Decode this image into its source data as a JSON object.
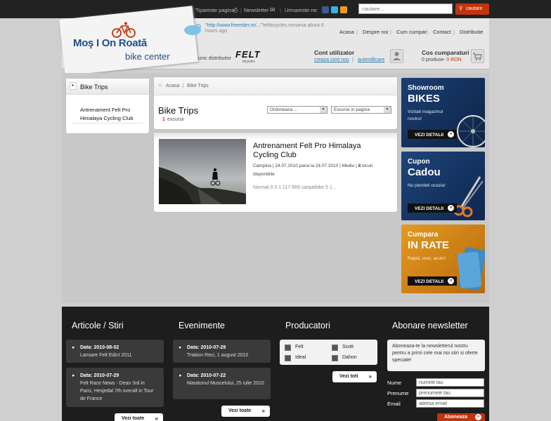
{
  "topbar": {
    "print_label": "Tipareste pagina",
    "newsletter_label": "Newsletter",
    "follow_label": "Urmareste-ne:",
    "search_placeholder": "cautare...",
    "search_button": "cautare"
  },
  "header": {
    "logo_line1": "Moş I On Roată",
    "logo_line2": "bike center",
    "tweet_link": "\"http://www.freerider.ro/...\"",
    "tweet_text": "feltbicycles.romania about 6 hours ago",
    "nav": [
      "Acasa",
      "Despre noi",
      "Cum cumpar",
      "Contact",
      "Distributie"
    ],
    "distributor_label": "unic distribuitor",
    "distributor_brand": "FELT",
    "distributor_sub": "bicycles",
    "account_title": "Cont utilizator",
    "account_create": "creaza cont nou",
    "account_login": "autentificare",
    "cart_title": "Cos cumparaturi",
    "cart_products": "0 produse",
    "cart_total": "- 0 RON"
  },
  "sidebar": {
    "title": "Bike Trips",
    "item": "Antrenament Felt Pro Himalaya Cycling Club"
  },
  "main": {
    "breadcrumb_home": "Acasa",
    "breadcrumb_current": "Bike Trips",
    "title": "Bike Trips",
    "count": "1",
    "count_label": "excursii",
    "sort_select": "Ordoneaza ...",
    "perpage_select": "Excursii in pagina",
    "trip": {
      "title": "Antrenament Felt Pro Himalaya Cycling Club",
      "meta_plain": "Campina | 24.07.2010 pana la 24.07.2010 | Mediu |",
      "meta_seats": "8",
      "meta_seats_label": "locuri disponibile",
      "desc": "Normal 0 0 1 117 669 carpatbike 5 1..."
    }
  },
  "banners": [
    {
      "t1": "Showroom",
      "t2": "BIKES",
      "t3": "Vizitati magazinul nostru!",
      "btn": "VEZI DETALII"
    },
    {
      "t1": "Cupon",
      "t2": "Cadou",
      "t3": "Nu pierdeti ocazia!",
      "btn": "VEZI DETALII"
    },
    {
      "t1": "Cumpara",
      "t2": "IN RATE",
      "t3": "Rapid, usor, acum!",
      "btn": "VEZI DETALII"
    }
  ],
  "footer": {
    "articles_title": "Articole / Stiri",
    "articles": [
      {
        "date": "Data: 2010-08-02",
        "text": "Lansare Felt Edict 2011"
      },
      {
        "date": "Data: 2010-07-29",
        "text": "Felt Race News - Dean 3rd in Paris, Hesjedal 7th overall in Tour de France"
      }
    ],
    "articles_more": "Vezi toate",
    "events_title": "Evenimente",
    "events": [
      {
        "date": "Data: 2010-07-29",
        "text": "Triation Reci, 1 august 2010"
      },
      {
        "date": "Data: 2010-07-22",
        "text": "Maratonul Muscelului, 25 iulie 2010"
      }
    ],
    "events_more": "Vezi toate",
    "producers_title": "Producatori",
    "producers": [
      "Felt",
      "Scott",
      "Ideal",
      "Dahon"
    ],
    "producers_more": "Vezi toti",
    "newsletter_title": "Abonare newsletter",
    "newsletter_text": "Aboneaza-te la newsletterul nostru pentru a primi cele mai noi stiri si oferte speciale!",
    "name_label": "Nume",
    "name_value": "numele tau",
    "first_label": "Prenume",
    "first_value": "prenumele tau",
    "email_label": "Email",
    "email_value": "adresa email",
    "subscribe": "Aboneaza"
  },
  "colors": {
    "accent": "#c2340d",
    "dark": "#1d1d1d",
    "link": "#2a7bb4"
  }
}
